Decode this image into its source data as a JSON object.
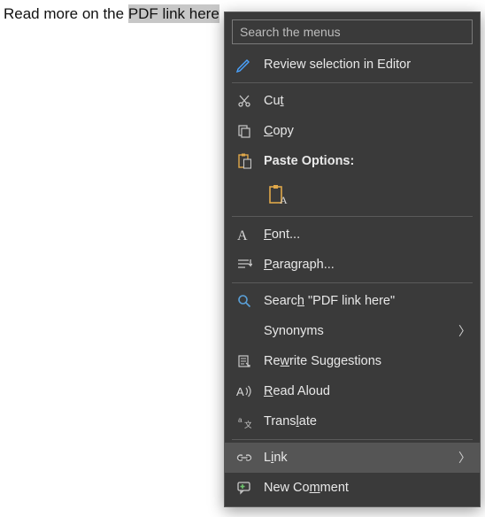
{
  "document": {
    "text_before": "Read more on the ",
    "text_selected": "PDF link here"
  },
  "menu": {
    "search_placeholder": "Search the menus",
    "review_label": "Review selection in Editor",
    "cut_label": "Cut",
    "cut_mn": "t",
    "copy_label": "Copy",
    "copy_mn": "C",
    "paste_header": "Paste Options:",
    "font_label": "Font...",
    "font_mn": "F",
    "paragraph_label": "Paragraph...",
    "paragraph_mn": "P",
    "search_item_prefix": "Search ",
    "search_item_term": "\"PDF link here\"",
    "search_item_mn": "h",
    "synonyms_label": "Synonyms",
    "rewrite_label": "Rewrite Suggestions",
    "rewrite_mn": "w",
    "read_aloud_label": "Read Aloud",
    "read_aloud_mn": "R",
    "translate_label": "Translate",
    "translate_mn": "l",
    "link_label": "Link",
    "link_mn": "i",
    "new_comment_label": "New Comment",
    "new_comment_mn": "m"
  }
}
